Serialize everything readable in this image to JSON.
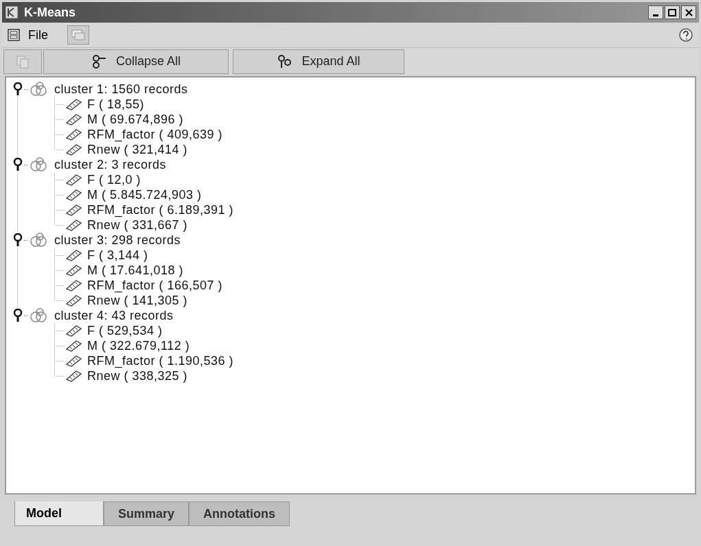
{
  "window": {
    "title": "K-Means"
  },
  "menu": [
    {
      "label": "File"
    }
  ],
  "toolbar": [
    {
      "label": "Collapse All"
    },
    {
      "label": "Expand All"
    }
  ],
  "tree": [
    {
      "label": "cluster 1: 1560 records",
      "expanded": true,
      "children": [
        {
          "label": "F ( 18,55)"
        },
        {
          "label": "M ( 69.674,896 )"
        },
        {
          "label": "RFM_factor ( 409,639 )"
        },
        {
          "label": "Rnew ( 321,414 )"
        }
      ]
    },
    {
      "label": "cluster 2: 3 records",
      "expanded": true,
      "children": [
        {
          "label": "F ( 12,0 )"
        },
        {
          "label": "M ( 5.845.724,903 )"
        },
        {
          "label": "RFM_factor ( 6.189,391 )"
        },
        {
          "label": "Rnew ( 331,667 )"
        }
      ]
    },
    {
      "label": "cluster 3: 298 records",
      "expanded": true,
      "children": [
        {
          "label": "F ( 3,144 )"
        },
        {
          "label": "M ( 17.641,018 )"
        },
        {
          "label": "RFM_factor ( 166,507 )"
        },
        {
          "label": "Rnew ( 141,305 )"
        }
      ]
    },
    {
      "label": "cluster 4: 43 records",
      "expanded": true,
      "children": [
        {
          "label": "F ( 529,534 )"
        },
        {
          "label": "M ( 322.679,112 )"
        },
        {
          "label": "RFM_factor ( 1.190,536 )"
        },
        {
          "label": "Rnew ( 338,325 )"
        }
      ]
    }
  ],
  "tabs": [
    {
      "label": "Model",
      "selected": true
    },
    {
      "label": "Summary",
      "selected": false
    },
    {
      "label": "Annotations",
      "selected": false
    }
  ]
}
